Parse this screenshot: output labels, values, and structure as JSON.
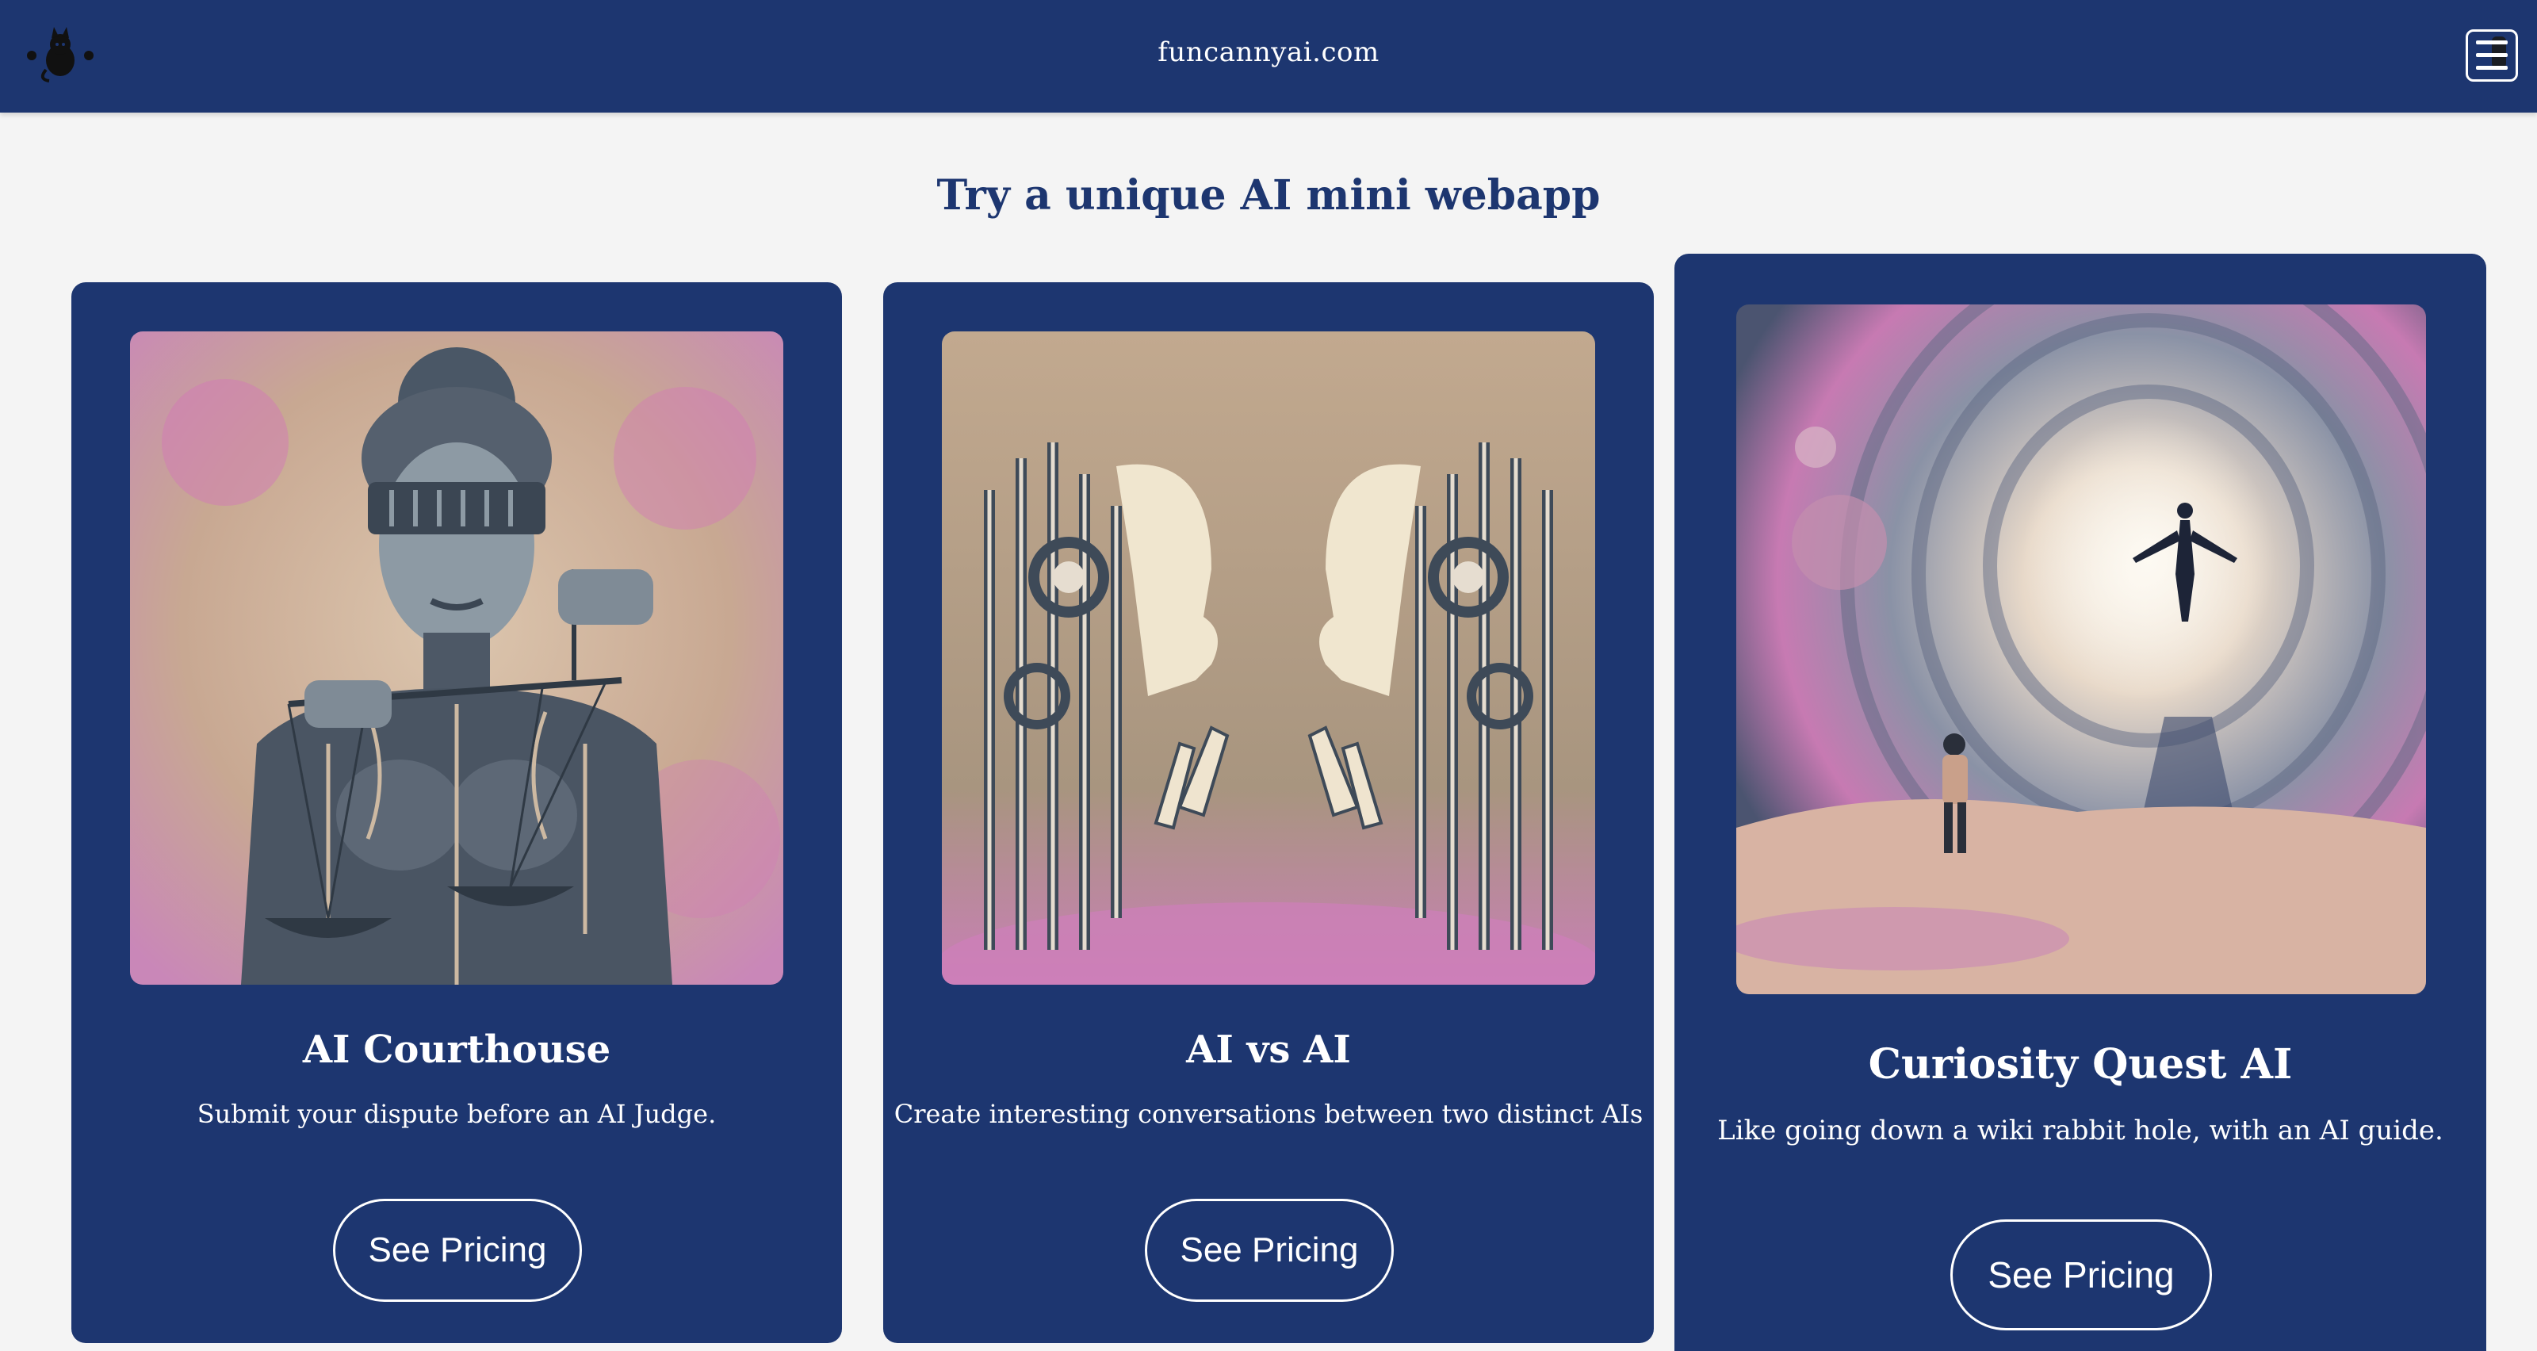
{
  "header": {
    "site_name": "funcannyai.com",
    "logo_icon": "cat-silhouette-logo",
    "menu_icon": "hamburger-menu-icon"
  },
  "page": {
    "heading": "Try a unique AI mini webapp"
  },
  "cards": [
    {
      "title": "AI Courthouse",
      "description": "Submit your dispute before an AI Judge.",
      "button_label": "See Pricing",
      "image_icon": "justice-robot-illustration"
    },
    {
      "title": "AI vs AI",
      "description": "Create interesting conversations between two distinct AIs",
      "button_label": "See Pricing",
      "image_icon": "robot-faces-illustration"
    },
    {
      "title": "Curiosity Quest AI",
      "description": "Like going down a wiki rabbit hole, with an AI guide.",
      "button_label": "See Pricing",
      "image_icon": "cosmic-portal-illustration"
    }
  ],
  "colors": {
    "navy": "#1d3670",
    "background": "#f4f4f4",
    "pink": "#d77ab8",
    "beige": "#c9b29b"
  }
}
